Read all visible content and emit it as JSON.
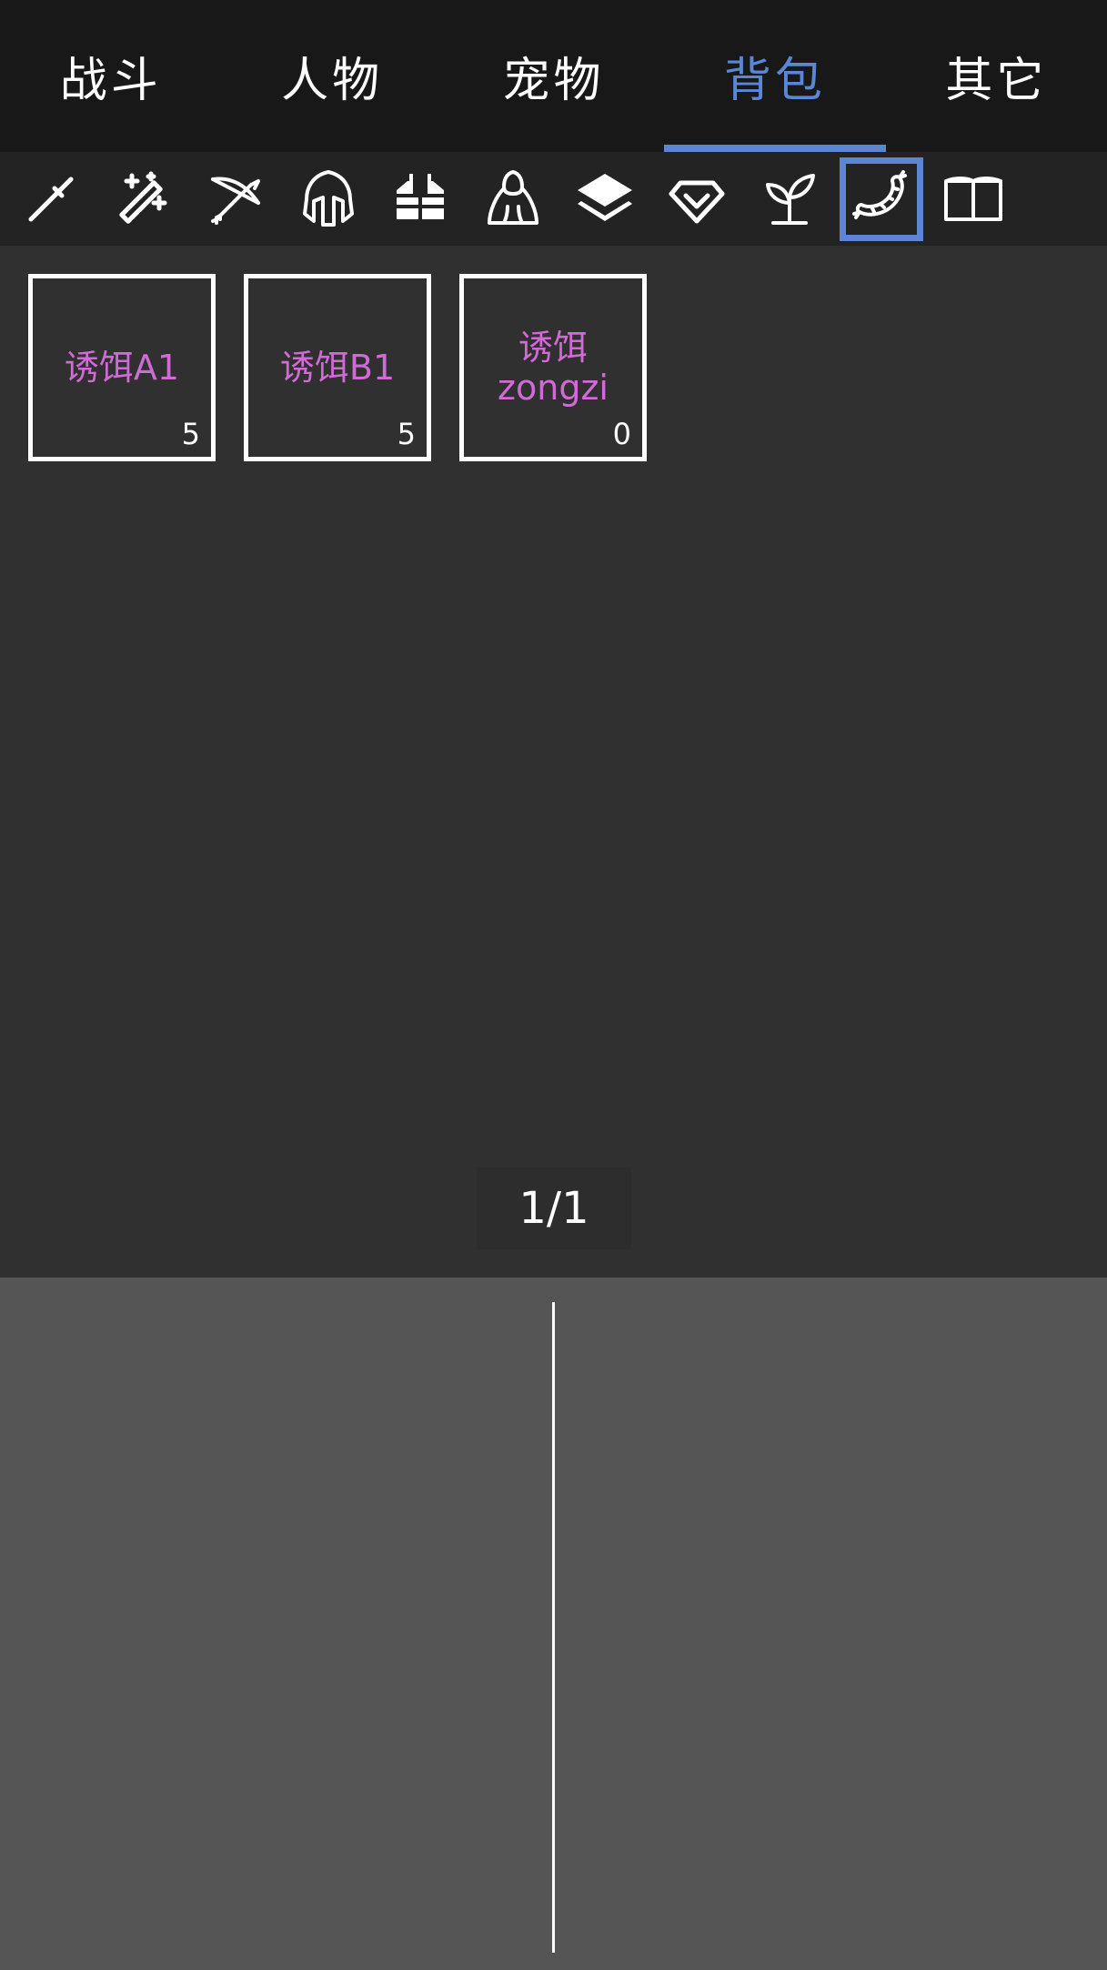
{
  "tabs": [
    {
      "label": "战斗",
      "active": false
    },
    {
      "label": "人物",
      "active": false
    },
    {
      "label": "宠物",
      "active": false
    },
    {
      "label": "背包",
      "active": true
    },
    {
      "label": "其它",
      "active": false
    }
  ],
  "categories": [
    {
      "icon": "sword-icon",
      "selected": false
    },
    {
      "icon": "magic-wand-icon",
      "selected": false
    },
    {
      "icon": "bow-icon",
      "selected": false
    },
    {
      "icon": "helmet-icon",
      "selected": false
    },
    {
      "icon": "vest-icon",
      "selected": false
    },
    {
      "icon": "cloak-icon",
      "selected": false
    },
    {
      "icon": "layers-icon",
      "selected": false
    },
    {
      "icon": "gem-icon",
      "selected": false
    },
    {
      "icon": "sprout-icon",
      "selected": false
    },
    {
      "icon": "bait-icon",
      "selected": true
    },
    {
      "icon": "book-icon",
      "selected": false
    }
  ],
  "items": [
    {
      "name": "诱饵A1",
      "count": "5"
    },
    {
      "name": "诱饵B1",
      "count": "5"
    },
    {
      "name": "诱饵\nzongzi",
      "count": "0"
    }
  ],
  "pager": {
    "text": "1/1"
  },
  "colors": {
    "accent": "#5b86d6",
    "item_name": "#d06bd6"
  }
}
